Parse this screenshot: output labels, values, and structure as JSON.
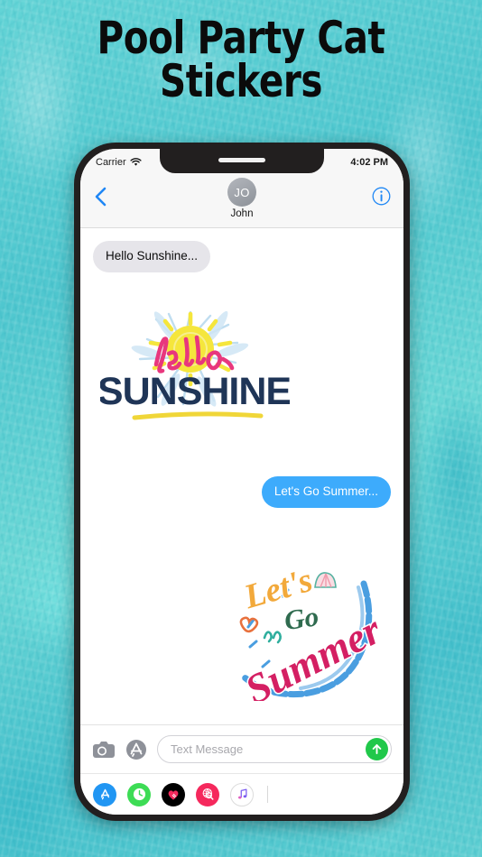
{
  "page": {
    "headline_line1": "Pool Party Cat",
    "headline_line2": "Stickers",
    "background_color": "#5ccfd4",
    "headline_color": "#0b0b0b"
  },
  "phone": {
    "status_bar": {
      "carrier": "Carrier",
      "wifi_icon": "wifi-icon",
      "time": "4:02 PM"
    },
    "nav_bar": {
      "back_icon": "chevron-left-icon",
      "avatar_initials": "JO",
      "contact_name": "John",
      "info_icon": "info-circle-icon"
    },
    "conversation": [
      {
        "kind": "text",
        "direction": "incoming",
        "text": "Hello Sunshine...",
        "bubble_color": "#e6e5ea",
        "text_color": "#0b0b0b"
      },
      {
        "kind": "sticker",
        "direction": "incoming",
        "name": "hello-sunshine-sticker",
        "script_word": "hello",
        "main_word": "SUNSHINE",
        "colors": {
          "sun": "#f5e63c",
          "script": "#e8377d",
          "lettering": "#1f3557",
          "fronds": "#bfddf0",
          "underline": "#f0d638"
        }
      },
      {
        "kind": "text",
        "direction": "outgoing",
        "text": "Let's Go Summer...",
        "bubble_color": "#3dabfc",
        "text_color": "#ffffff"
      },
      {
        "kind": "sticker",
        "direction": "outgoing",
        "name": "lets-go-summer-sticker",
        "word1": "Let's",
        "word2": "Go",
        "word3": "Summer",
        "colors": {
          "word1": "#f2a93b",
          "word2": "#2f6b4f",
          "word3": "#d41f63",
          "wave": "#4a9ee0",
          "shell": "#f4b9c4",
          "heart": "#e8713d",
          "squiggle": "#2fae9e"
        }
      }
    ],
    "input_bar": {
      "camera_icon": "camera-icon",
      "app_store_icon": "app-store-icon",
      "placeholder": "Text Message",
      "send_icon": "send-arrow-up-icon",
      "send_color": "#20c84a"
    },
    "app_drawer": [
      {
        "name": "app-store",
        "icon": "app-store-icon",
        "color": "#2196f3"
      },
      {
        "name": "recents",
        "icon": "clock-icon",
        "color": "#3ddc55"
      },
      {
        "name": "digital-touch",
        "icon": "heart-icon",
        "color": "#000000"
      },
      {
        "name": "images",
        "icon": "globe-search-icon",
        "color": "#f5285c"
      },
      {
        "name": "music",
        "icon": "music-note-icon",
        "color": "#ffffff"
      }
    ]
  }
}
